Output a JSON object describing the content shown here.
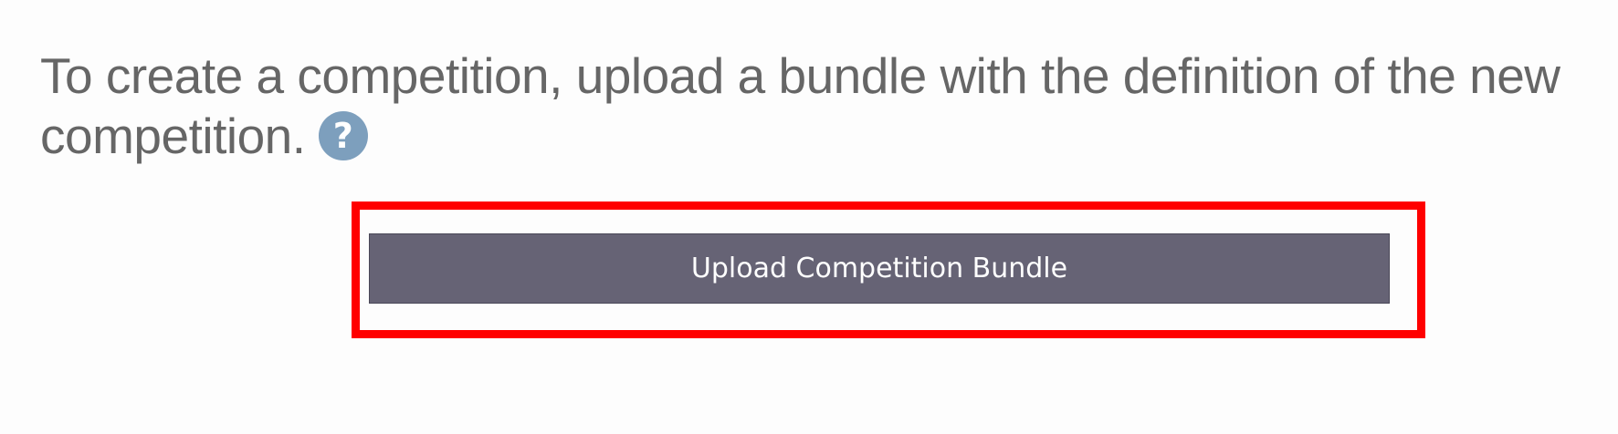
{
  "intro": {
    "text": "To create a competition, upload a bundle with the definition of the new competition.",
    "help_icon_glyph": "?",
    "help_icon_name": "question-circle-icon",
    "help_icon_color": "#7d9fbd"
  },
  "upload": {
    "button_label": "Upload Competition Bundle",
    "button_color": "#666375",
    "highlight_color": "#ff0000"
  }
}
